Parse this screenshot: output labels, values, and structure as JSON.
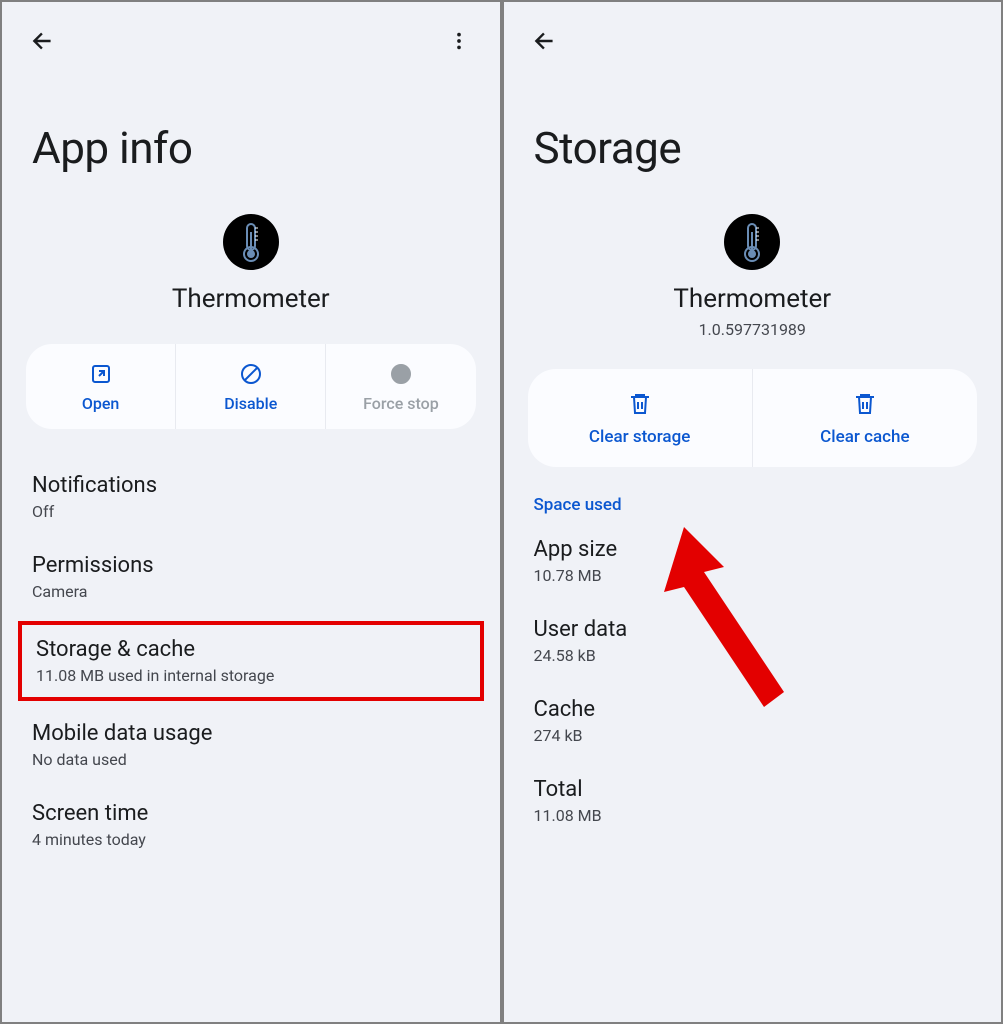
{
  "left": {
    "title": "App info",
    "app_name": "Thermometer",
    "actions": {
      "open": "Open",
      "disable": "Disable",
      "force_stop": "Force stop"
    },
    "items": {
      "notifications": {
        "title": "Notifications",
        "sub": "Off"
      },
      "permissions": {
        "title": "Permissions",
        "sub": "Camera"
      },
      "storage": {
        "title": "Storage & cache",
        "sub": "11.08 MB used in internal storage"
      },
      "mobile_data": {
        "title": "Mobile data usage",
        "sub": "No data used"
      },
      "screen_time": {
        "title": "Screen time",
        "sub": "4 minutes today"
      }
    }
  },
  "right": {
    "title": "Storage",
    "app_name": "Thermometer",
    "version": "1.0.597731989",
    "actions": {
      "clear_storage": "Clear storage",
      "clear_cache": "Clear cache"
    },
    "section_label": "Space used",
    "items": {
      "app_size": {
        "title": "App size",
        "sub": "10.78 MB"
      },
      "user_data": {
        "title": "User data",
        "sub": "24.58 kB"
      },
      "cache": {
        "title": "Cache",
        "sub": "274 kB"
      },
      "total": {
        "title": "Total",
        "sub": "11.08 MB"
      }
    }
  }
}
